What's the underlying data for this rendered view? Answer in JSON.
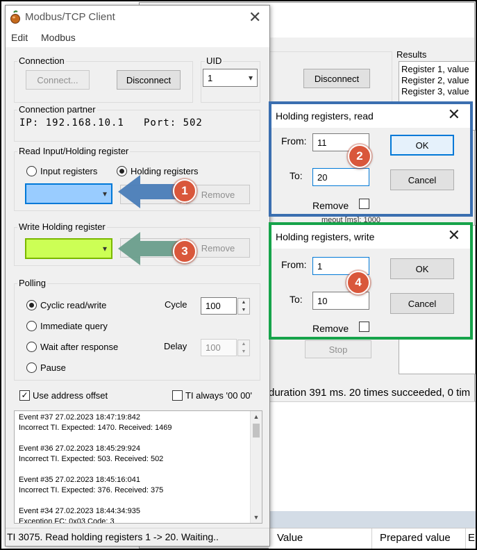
{
  "background_window": {
    "disconnect_label": "Disconnect",
    "results_label": "Results",
    "results_items": [
      "Register 1, value",
      "Register 2, value",
      "Register 3, value"
    ],
    "timeout_fragment": "meout [ms]: 1000",
    "stop_label": "Stop",
    "duration_text": "duration 391 ms. 20 times succeeded, 0 tim",
    "columns": [
      "Value",
      "Prepared value",
      "E"
    ]
  },
  "main": {
    "title": "Modbus/TCP Client",
    "menu": [
      "Edit",
      "Modbus"
    ],
    "connection": {
      "group_label": "Connection",
      "connect_label": "Connect...",
      "disconnect_label": "Disconnect"
    },
    "uid": {
      "label": "UID",
      "value": "1"
    },
    "partner": {
      "label": "Connection partner",
      "ip": "IP: 192.168.10.1",
      "port": "Port: 502"
    },
    "read": {
      "group_label": "Read Input/Holding register",
      "input_label": "Input registers",
      "holding_label": "Holding registers",
      "remove_label": "Remove"
    },
    "write": {
      "group_label": "Write Holding register",
      "remove_label": "Remove"
    },
    "polling": {
      "group_label": "Polling",
      "options": [
        "Cyclic read/write",
        "Immediate query",
        "Wait after response",
        "Pause"
      ],
      "cycle_label": "Cycle",
      "cycle_value": "100",
      "delay_label": "Delay",
      "delay_value": "100"
    },
    "use_offset_label": "Use address offset",
    "ti_label": "TI always '00 00'",
    "log": [
      {
        "head": "Event #37  27.02.2023 18:47:19:842",
        "body": "Incorrect TI. Expected: 1470. Received: 1469"
      },
      {
        "head": "Event #36  27.02.2023 18:45:29:924",
        "body": "Incorrect TI. Expected: 503. Received: 502"
      },
      {
        "head": "Event #35  27.02.2023 18:45:16:041",
        "body": "Incorrect TI. Expected: 376. Received: 375"
      },
      {
        "head": "Event #34  27.02.2023 18:44:34:935",
        "body": "Exception FC: 0x03 Code: 3"
      }
    ],
    "status": "TI 3075. Read holding registers 1 -> 20. Waiting.."
  },
  "popup_read": {
    "title": "Holding registers, read",
    "from_label": "From:",
    "from_value": "11",
    "to_label": "To:",
    "to_value": "20",
    "remove_label": "Remove",
    "ok_label": "OK",
    "cancel_label": "Cancel"
  },
  "popup_write": {
    "title": "Holding registers, write",
    "from_label": "From:",
    "from_value": "1",
    "to_label": "To:",
    "to_value": "10",
    "remove_label": "Remove",
    "ok_label": "OK",
    "cancel_label": "Cancel"
  },
  "badges": [
    "1",
    "2",
    "3",
    "4"
  ],
  "colors": {
    "read_combo": "#99ccff",
    "write_combo": "#ccff55",
    "arrow_blue": "#4a7db8",
    "arrow_teal": "#6a9e8c",
    "read_popup_border": "#3b6fb0",
    "write_popup_border": "#16a34a",
    "badge": "#d9573b"
  }
}
